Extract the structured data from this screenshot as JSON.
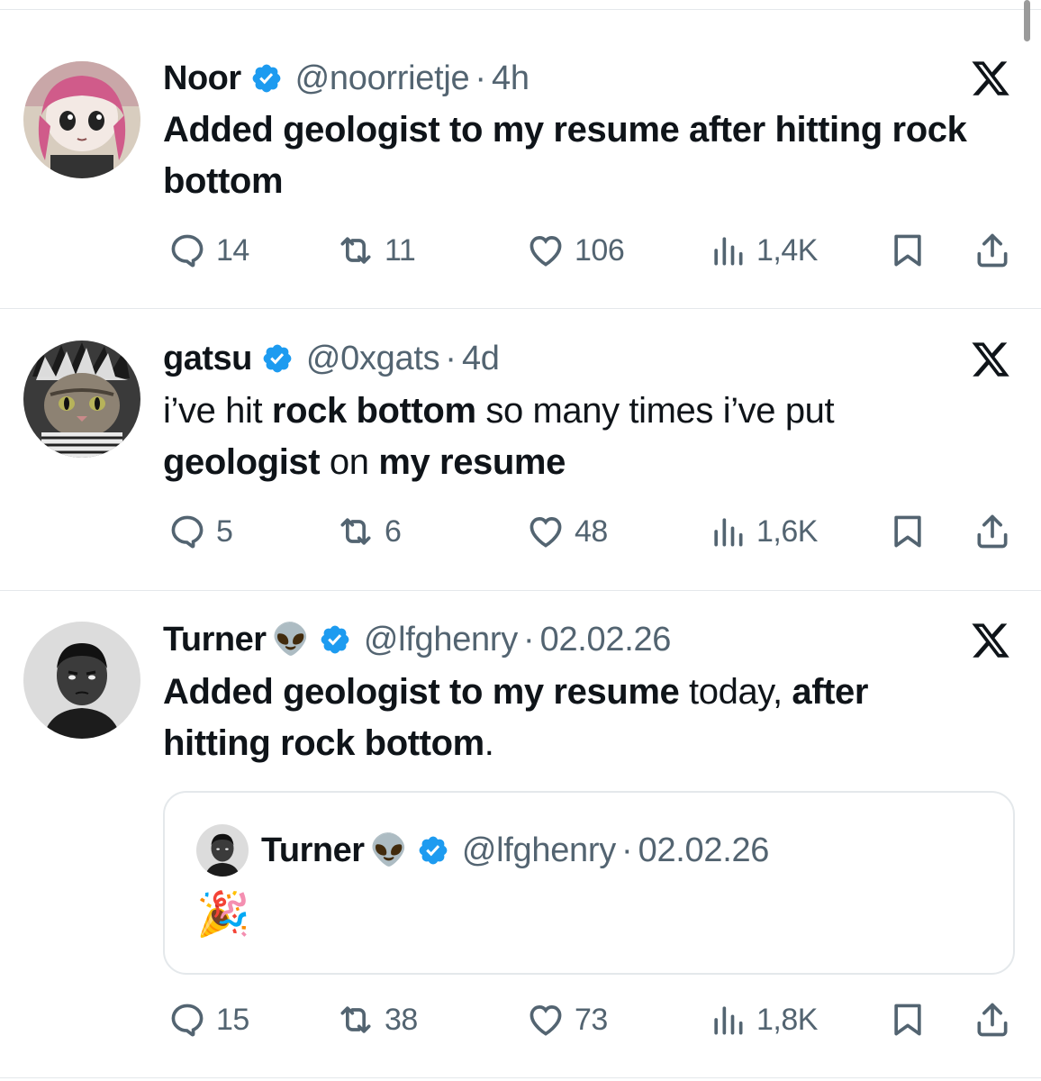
{
  "tweets": [
    {
      "name": "Noor",
      "handle": "@noorrietje",
      "time": "4h",
      "text_parts": [
        {
          "t": "Added geologist to my resume after hitting rock bottom",
          "b": true
        }
      ],
      "actions": {
        "replies": "14",
        "reposts": "11",
        "likes": "106",
        "views": "1,4K"
      }
    },
    {
      "name": "gatsu",
      "handle": "@0xgats",
      "time": "4d",
      "text_parts": [
        {
          "t": "i’ve hit ",
          "b": false
        },
        {
          "t": "rock bottom",
          "b": true
        },
        {
          "t": " so many times i’ve put ",
          "b": false
        },
        {
          "t": "geologist",
          "b": true
        },
        {
          "t": " on ",
          "b": false
        },
        {
          "t": "my resume",
          "b": true
        }
      ],
      "actions": {
        "replies": "5",
        "reposts": "6",
        "likes": "48",
        "views": "1,6K"
      }
    },
    {
      "name": "Turner",
      "name_emoji": "👽",
      "handle": "@lfghenry",
      "time": "02.02.26",
      "text_parts": [
        {
          "t": "Added geologist to my resume",
          "b": true
        },
        {
          "t": " today, ",
          "b": false
        },
        {
          "t": "after hitting rock bottom",
          "b": true
        },
        {
          "t": ".",
          "b": false
        }
      ],
      "quote": {
        "name": "Turner",
        "name_emoji": "👽",
        "handle": "@lfghenry",
        "time": "02.02.26",
        "text": "🎉"
      },
      "actions": {
        "replies": "15",
        "reposts": "38",
        "likes": "73",
        "views": "1,8K"
      }
    }
  ],
  "separator": "·",
  "icons": {
    "verified": "verified-badge-icon",
    "platform": "x-logo-icon",
    "reply": "reply-icon",
    "repost": "repost-icon",
    "like": "heart-icon",
    "views": "views-icon",
    "bookmark": "bookmark-icon",
    "share": "share-icon"
  },
  "colors": {
    "text": "#0f1419",
    "muted": "#536471",
    "verified": "#1d9bf0",
    "divider": "#e4e8eb"
  }
}
